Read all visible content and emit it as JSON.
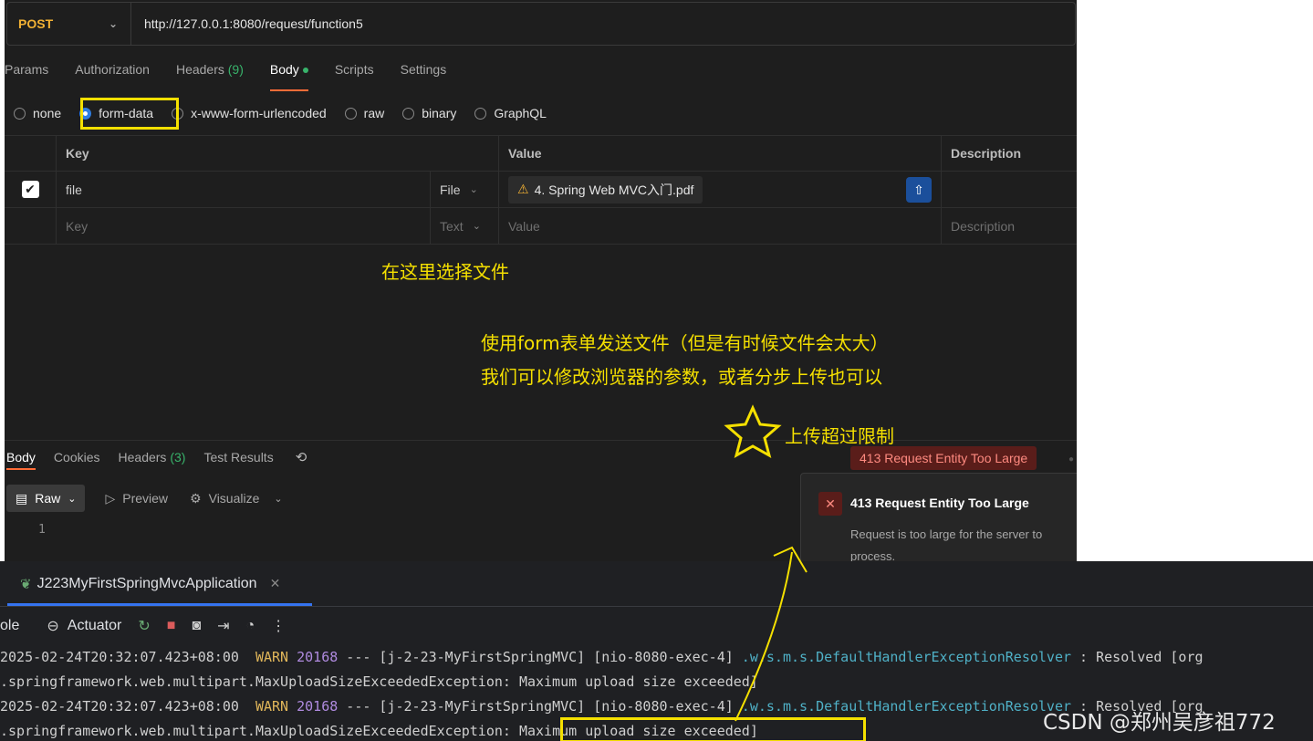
{
  "request": {
    "method": "POST",
    "url": "http://127.0.0.1:8080/request/function5"
  },
  "req_tabs": [
    {
      "label": "Params"
    },
    {
      "label": "Authorization"
    },
    {
      "label": "Headers",
      "count": "(9)"
    },
    {
      "label": "Body"
    },
    {
      "label": "Scripts"
    },
    {
      "label": "Settings"
    }
  ],
  "body_types": [
    "none",
    "form-data",
    "x-www-form-urlencoded",
    "raw",
    "binary",
    "GraphQL"
  ],
  "table": {
    "headers": {
      "key": "Key",
      "value": "Value",
      "description": "Description"
    },
    "row": {
      "key": "file",
      "type": "File",
      "value": "4. Spring Web MVC入门.pdf"
    },
    "placeholder": {
      "key": "Key",
      "type": "Text",
      "value": "Value",
      "description": "Description"
    }
  },
  "annotations": {
    "choose_file": "在这里选择文件",
    "line1": "使用form表单发送文件（但是有时候文件会太大）",
    "line2": "我们可以修改浏览器的参数，或者分步上传也可以",
    "limit": "上传超过限制"
  },
  "response": {
    "tabs": [
      {
        "label": "Body"
      },
      {
        "label": "Cookies"
      },
      {
        "label": "Headers",
        "count": "(3)"
      },
      {
        "label": "Test Results"
      }
    ],
    "status": "413 Request Entity Too Large",
    "view": {
      "raw": "Raw",
      "preview": "Preview",
      "visualize": "Visualize"
    },
    "line_number": "1"
  },
  "toast": {
    "title": "413 Request Entity Too Large",
    "message": "Request is too large for the server to process."
  },
  "ide": {
    "tab_title": "J223MyFirstSpringMvcApplication",
    "toolbar": {
      "console": "ole",
      "actuator": "Actuator"
    },
    "logs": {
      "l1_ts": "2025-02-24T20:32:07.423+08:00",
      "l1_level": "WARN",
      "l1_pid": "20168",
      "l1_mid": " --- [j-2-23-MyFirstSpringMVC] [nio-8080-exec-4] ",
      "l1_class": ".w.s.m.s.DefaultHandlerExceptionResolver",
      "l1_tail": " : Resolved [org",
      "l2": ".springframework.web.multipart.MaxUploadSizeExceededException: Maximum upload size exceeded]",
      "l3_ts": "2025-02-24T20:32:07.423+08:00",
      "l3_level": "WARN",
      "l3_pid": "20168",
      "l3_mid": " --- [j-2-23-MyFirstSpringMVC] [nio-8080-exec-4] ",
      "l3_class": ".w.s.m.s.DefaultHandlerExceptionResolver",
      "l3_tail": " : Resolved [org",
      "l4_pre": ".springframework.web.multipart.MaxUploadSizeExceededException: ",
      "l4_hl": "Maximum upload size exceeded]"
    }
  },
  "watermark": "CSDN @郑州吴彦祖772",
  "colors": {
    "accent": "#ff6c37",
    "annotation": "#f5e000",
    "error": "#ff8a80"
  }
}
